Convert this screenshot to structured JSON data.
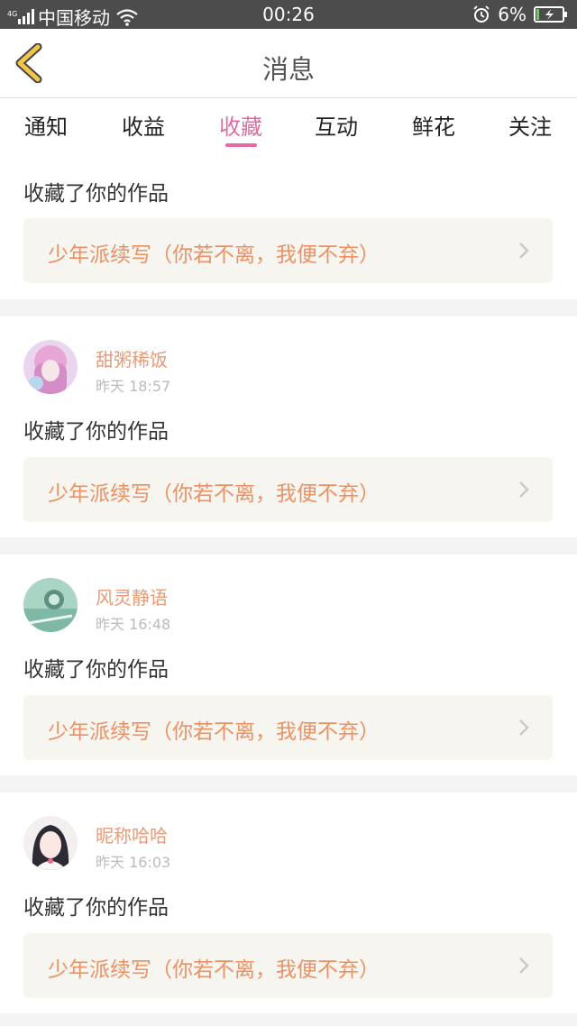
{
  "status_bar": {
    "network": "4G",
    "carrier": "中国移动",
    "time": "00:26",
    "battery": "6%"
  },
  "header": {
    "title": "消息"
  },
  "tabs": [
    {
      "label": "通知"
    },
    {
      "label": "收益"
    },
    {
      "label": "收藏",
      "active": true
    },
    {
      "label": "互动"
    },
    {
      "label": "鲜花"
    },
    {
      "label": "关注"
    }
  ],
  "messages": [
    {
      "user": "",
      "time": "",
      "action": "收藏了你的作品",
      "work": "少年派续写（你若不离，我便不弃）"
    },
    {
      "user": "甜粥稀饭",
      "time": "昨天 18:57",
      "action": "收藏了你的作品",
      "work": "少年派续写（你若不离，我便不弃）"
    },
    {
      "user": "风灵静语",
      "time": "昨天 16:48",
      "action": "收藏了你的作品",
      "work": "少年派续写（你若不离，我便不弃）"
    },
    {
      "user": "昵称哈哈",
      "time": "昨天 16:03",
      "action": "收藏了你的作品",
      "work": "少年派续写（你若不离，我便不弃）"
    }
  ],
  "colors": {
    "accent": "#e36ba1",
    "username": "#e99a76",
    "work_title": "#ec9164",
    "back_icon": "#f3c64a"
  }
}
